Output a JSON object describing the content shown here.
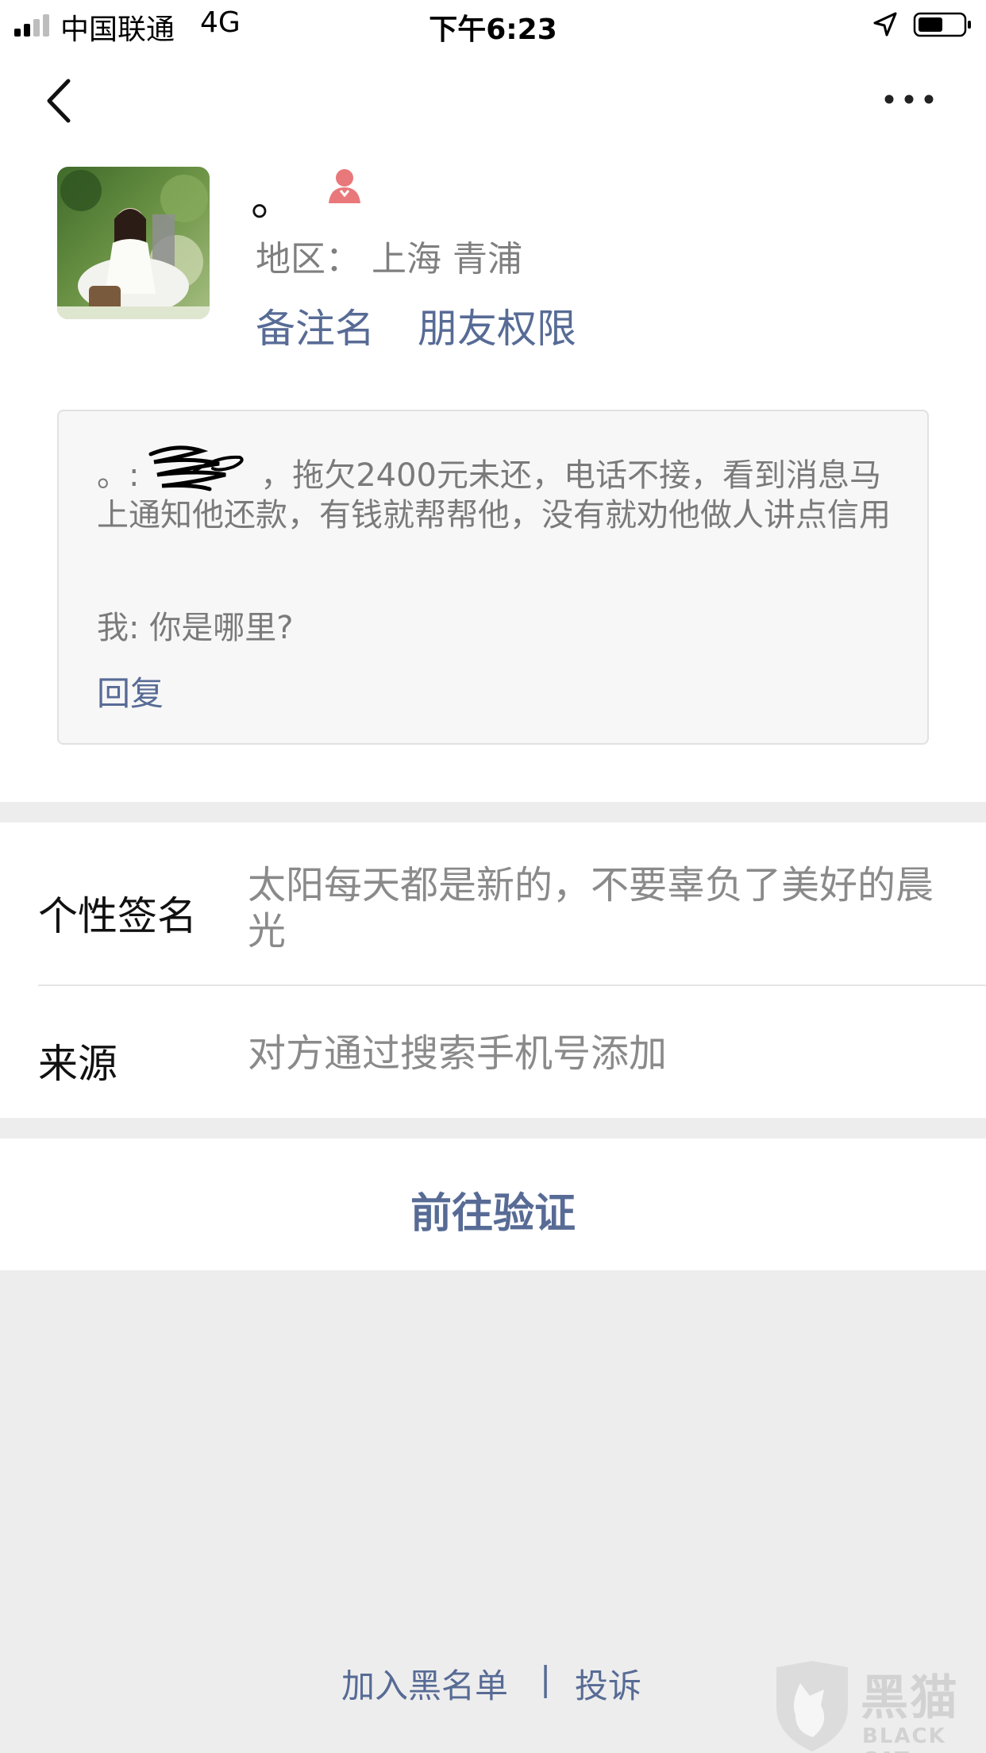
{
  "status_bar": {
    "carrier": "中国联通",
    "network": "4G",
    "time": "下午6:23"
  },
  "profile": {
    "nickname": "。",
    "gender_icon": "female-icon",
    "region": "地区：  上海 青浦",
    "remark_label": "备注名",
    "permission_label": "朋友权限"
  },
  "verify_message": {
    "sender_text": "。: ",
    "message_text": "，拖欠2400元未还，电话不接，看到消息马上通知他还款，有钱就帮帮他，没有就劝他做人讲点信用",
    "my_text": "我: 你是哪里?",
    "reply_label": "回复"
  },
  "info": {
    "signature_label": "个性签名",
    "signature_value": "太阳每天都是新的，不要辜负了美好的晨光",
    "source_label": "来源",
    "source_value": "对方通过搜索手机号添加"
  },
  "actions": {
    "verify_label": "前往验证"
  },
  "footer": {
    "blacklist_label": "加入黑名单",
    "separator": "|",
    "report_label": "投诉"
  },
  "watermark": {
    "cn": "黑猫",
    "en": "BLACK CAT"
  },
  "colors": {
    "link": "#576b95",
    "background": "#ededed",
    "gender_female": "#e9787a"
  }
}
